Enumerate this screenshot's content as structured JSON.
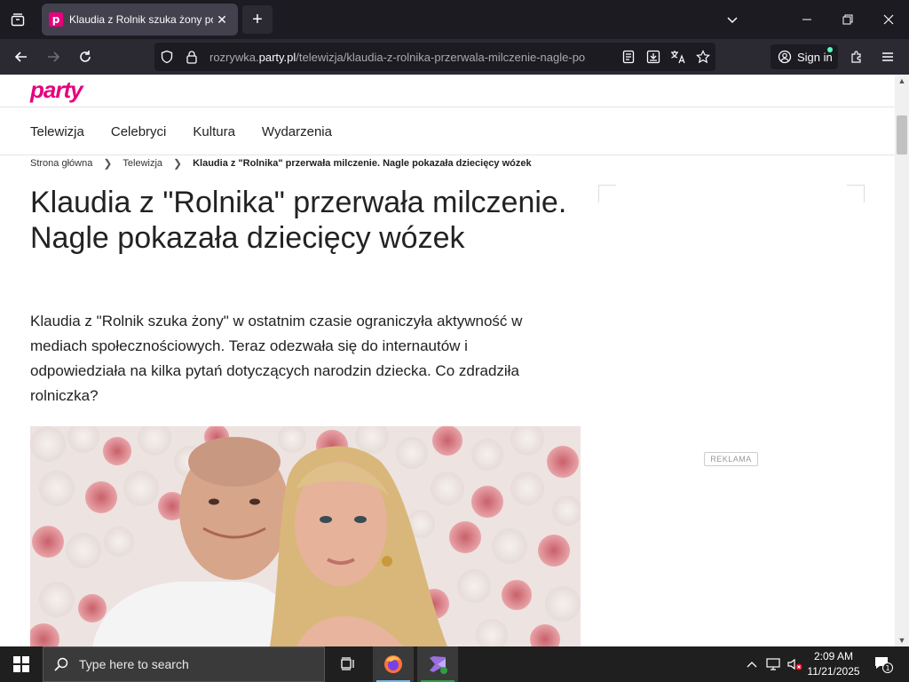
{
  "browser": {
    "tab_title": "Klaudia z Rolnik szuka żony pok",
    "favicon_letter": "p",
    "url_prefix": "rozrywka.",
    "url_domain": "party.pl",
    "url_path": "/telewizja/klaudia-z-rolnika-przerwala-milczenie-nagle-po",
    "sign_in": "Sign in"
  },
  "site": {
    "logo": "party",
    "menu": [
      "Telewizja",
      "Celebryci",
      "Kultura",
      "Wydarzenia"
    ],
    "breadcrumb": {
      "home": "Strona główna",
      "section": "Telewizja",
      "current": "Klaudia z \"Rolnika\" przerwała milczenie. Nagle pokazała dziecięcy wózek"
    }
  },
  "article": {
    "headline": "Klaudia z \"Rolnika\" przerwała milczenie. Nagle pokazała dziecięcy wózek",
    "lead": "Klaudia z \"Rolnik szuka żony\" w ostatnim czasie ograniczyła aktywność w mediach społecznościowych. Teraz odezwała się do internautów i odpowiedziała na kilka pytań dotyczących narodzin dziecka. Co zdradziła rolniczka?"
  },
  "ad": {
    "label": "REKLAMA"
  },
  "taskbar": {
    "search_placeholder": "Type here to search",
    "time": "2:09 AM",
    "date": "11/21/2025",
    "notification_count": "1"
  },
  "colors": {
    "brand": "#e6007e"
  }
}
